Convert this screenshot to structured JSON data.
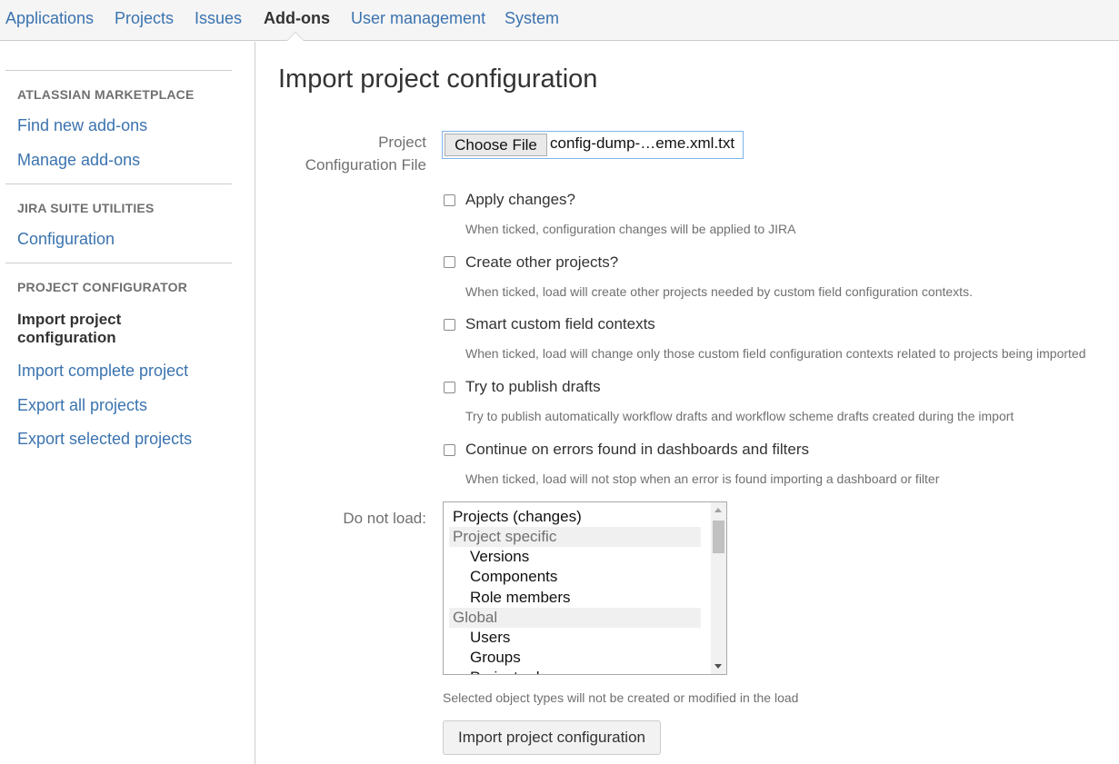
{
  "topnav": {
    "tabs": [
      {
        "label": "Applications"
      },
      {
        "label": "Projects"
      },
      {
        "label": "Issues"
      },
      {
        "label": "Add-ons",
        "active": true
      },
      {
        "label": "User management"
      },
      {
        "label": "System"
      }
    ]
  },
  "sidebar": {
    "sections": [
      {
        "heading": "ATLASSIAN MARKETPLACE",
        "items": [
          "Find new add-ons",
          "Manage add-ons"
        ]
      },
      {
        "heading": "JIRA SUITE UTILITIES",
        "items": [
          "Configuration"
        ]
      },
      {
        "heading": "PROJECT CONFIGURATOR",
        "items": [
          "Import project configuration",
          "Import complete project",
          "Export all projects",
          "Export selected projects"
        ],
        "current": "Import project configuration"
      }
    ]
  },
  "main": {
    "title": "Import project configuration",
    "file_field": {
      "label": "Project Configuration File",
      "button": "Choose File",
      "filename": "config-dump-…eme.xml.txt"
    },
    "options": [
      {
        "label": "Apply changes?",
        "desc": "When ticked, configuration changes will be applied to JIRA",
        "checked": false
      },
      {
        "label": "Create other projects?",
        "desc": "When ticked, load will create other projects needed by custom field configuration contexts.",
        "checked": false
      },
      {
        "label": "Smart custom field contexts",
        "desc": "When ticked, load will change only those custom field configuration contexts related to projects being imported",
        "checked": false
      },
      {
        "label": "Try to publish drafts",
        "desc": "Try to publish automatically workflow drafts and workflow scheme drafts created during the import",
        "checked": false
      },
      {
        "label": "Continue on errors found in dashboards and filters",
        "desc": "When ticked, load will not stop when an error is found importing a dashboard or filter",
        "checked": false
      }
    ],
    "do_not_load": {
      "label": "Do not load:",
      "options": [
        {
          "text": "Projects (changes)",
          "kind": "option"
        },
        {
          "text": "Project specific",
          "kind": "group"
        },
        {
          "text": "Versions",
          "kind": "child"
        },
        {
          "text": "Components",
          "kind": "child"
        },
        {
          "text": "Role members",
          "kind": "child"
        },
        {
          "text": "Global",
          "kind": "group"
        },
        {
          "text": "Users",
          "kind": "child"
        },
        {
          "text": "Groups",
          "kind": "child"
        },
        {
          "text": "Project roles",
          "kind": "child"
        }
      ],
      "hint": "Selected object types will not be created or modified in the load"
    },
    "submit_label": "Import project configuration"
  },
  "colors": {
    "link": "#3b73af",
    "text": "#333333",
    "muted": "#707070",
    "nav_bg": "#f5f5f5"
  }
}
